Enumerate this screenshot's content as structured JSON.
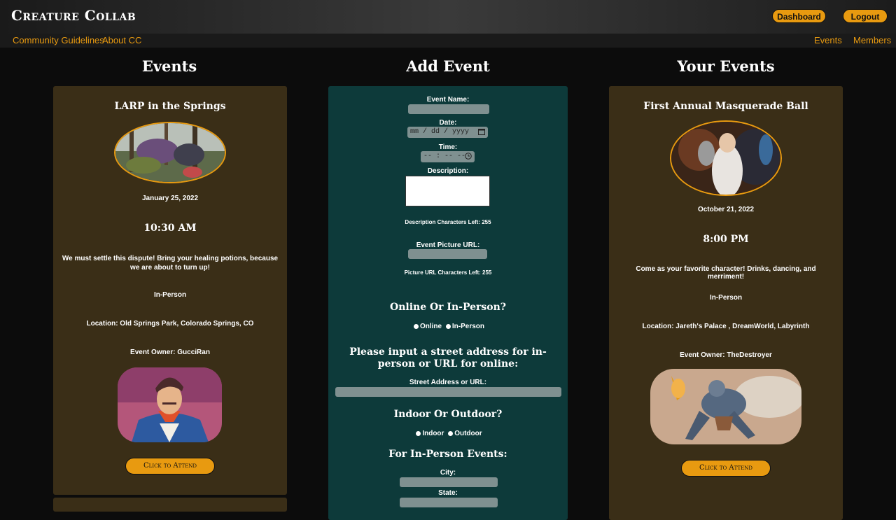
{
  "header": {
    "brand": "Creature Collab",
    "dashboard_label": "Dashboard",
    "logout_label": "Logout"
  },
  "subnav": {
    "left": [
      "Community Guidelines",
      "About CC"
    ],
    "right": [
      "Events",
      "Members"
    ]
  },
  "columns": {
    "events": "Events",
    "add_event": "Add Event",
    "your_events": "Your Events"
  },
  "event_left": {
    "title": "LARP in the Springs",
    "date": "January 25, 2022",
    "time": "10:30 AM",
    "description": "We must settle this dispute! Bring your healing potions, because we are about to turn up!",
    "mode": "In-Person",
    "location": "Location: Old Springs Park, Colorado Springs, CO",
    "owner": "Event Owner: GucciRan",
    "attend_label": "Click to Attend"
  },
  "event_right": {
    "title": "First Annual Masquerade Ball",
    "date": "October 21, 2022",
    "time": "8:00 PM",
    "description": "Come as your favorite character! Drinks, dancing, and merriment!",
    "mode": "In-Person",
    "location": "Location: Jareth's Palace , DreamWorld, Labyrinth",
    "owner": "Event Owner: TheDestroyer",
    "attend_label": "Click to Attend"
  },
  "form": {
    "event_name_label": "Event Name:",
    "date_label": "Date:",
    "date_placeholder": "mm / dd / yyyy",
    "time_label": "Time:",
    "time_placeholder": "-- : -- --",
    "description_label": "Description:",
    "description_chars": "Description Characters Left: 255",
    "picture_url_label": "Event Picture URL:",
    "picture_url_chars": "Picture URL Characters Left: 255",
    "online_heading": "Online Or In-Person?",
    "online_option": "Online",
    "inperson_option": "In-Person",
    "address_heading": "Please input a street address for in-person or URL for online:",
    "address_label": "Street Address or URL:",
    "indoor_heading": "Indoor Or Outdoor?",
    "indoor_option": "Indoor",
    "outdoor_option": "Outdoor",
    "inperson_heading": "For In-Person Events:",
    "city_label": "City:",
    "state_label": "State:"
  },
  "colors": {
    "accent": "#e89a10",
    "card_brown": "#3a2e17",
    "card_teal": "#0d3a3a",
    "input_gray": "#7f9090"
  }
}
